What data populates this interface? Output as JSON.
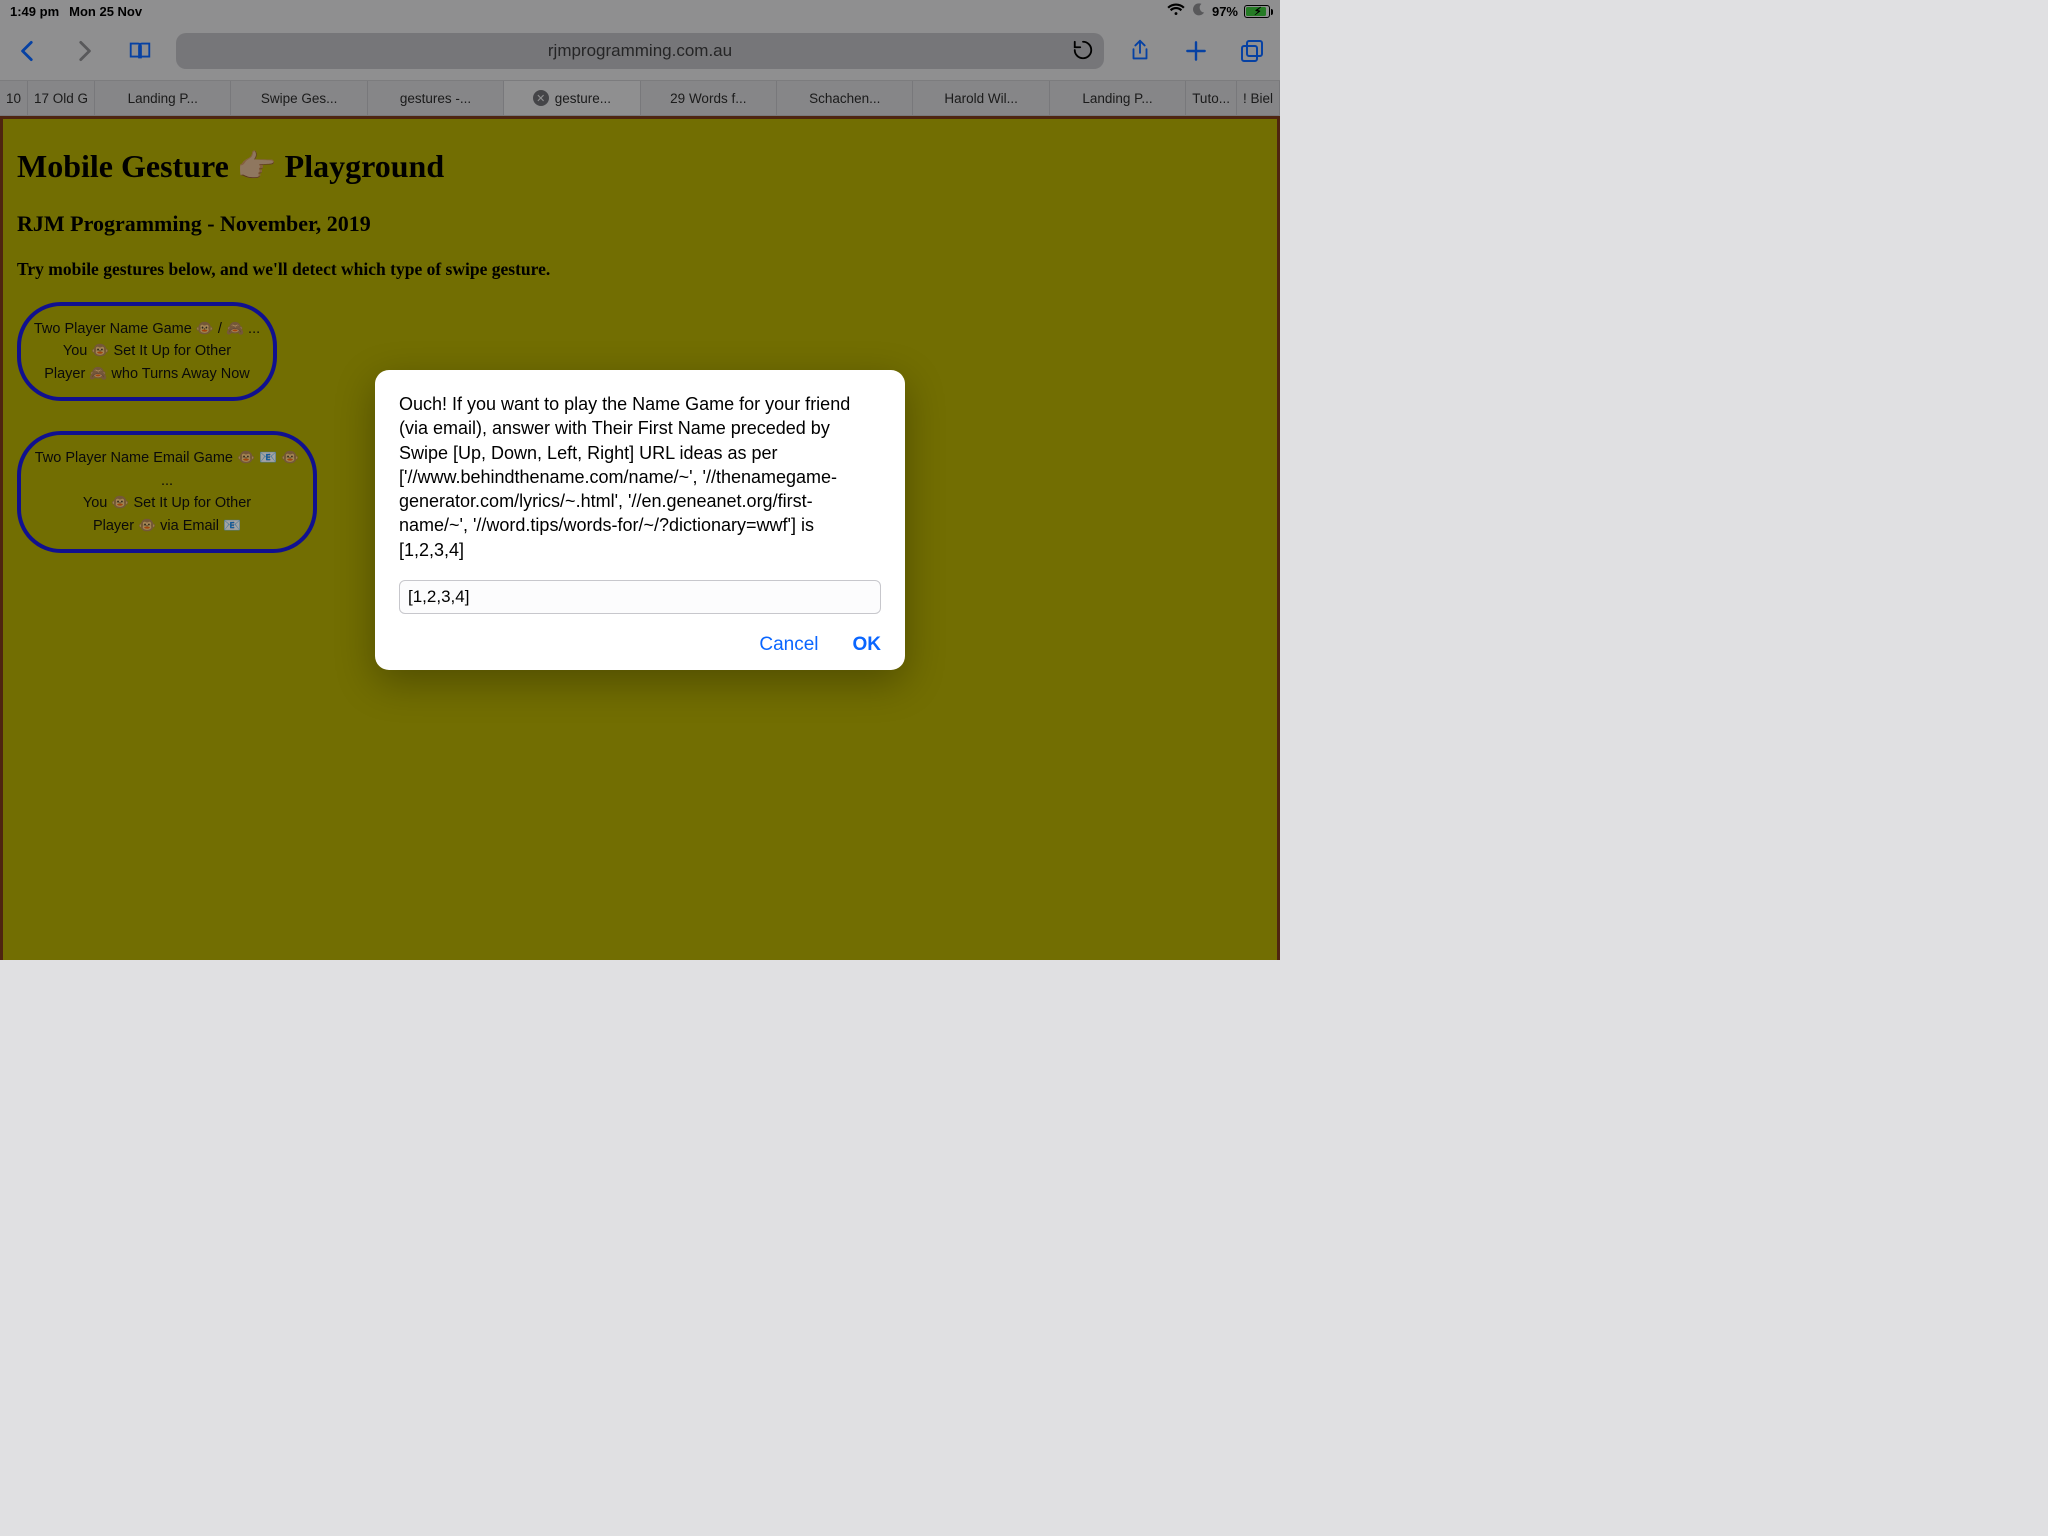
{
  "status": {
    "time": "1:49 pm",
    "date": "Mon 25 Nov",
    "battery_pct": "97%"
  },
  "toolbar": {
    "url_display": "rjmprogramming.com.au"
  },
  "tabs": [
    {
      "label": "10",
      "active": false,
      "narrow": true
    },
    {
      "label": "17 Old G",
      "active": false,
      "narrow": true
    },
    {
      "label": "Landing P...",
      "active": false
    },
    {
      "label": "Swipe Ges...",
      "active": false
    },
    {
      "label": "gestures -...",
      "active": false
    },
    {
      "label": "gesture...",
      "active": true,
      "closeable": true
    },
    {
      "label": "29 Words f...",
      "active": false
    },
    {
      "label": "Schachen...",
      "active": false
    },
    {
      "label": "Harold Wil...",
      "active": false
    },
    {
      "label": "Landing P...",
      "active": false
    },
    {
      "label": "Tuto...",
      "active": false,
      "narrow": true
    },
    {
      "label": "! Biel",
      "active": false,
      "narrow": true
    }
  ],
  "page": {
    "h1_a": "Mobile Gesture ",
    "h1_emoji": "👉🏼",
    "h1_b": " Playground",
    "h2": "RJM Programming - November, 2019",
    "h3": "Try mobile gestures below, and we'll detect which type of swipe gesture.",
    "bubble1_l1": "Two Player Name Game 🐵 / 🙈 ...",
    "bubble1_l2": "You 🐵 Set It Up for Other",
    "bubble1_l3": "Player 🙈 who Turns Away Now",
    "bubble2_l1": "Two Player Name Email Game 🐵 📧 🐵 ...",
    "bubble2_l2": "You 🐵 Set It Up for Other",
    "bubble2_l3": "Player 🐵 via Email 📧"
  },
  "dialog": {
    "message": "Ouch!  If you want to play the Name Game for your friend (via email), answer with Their First Name preceded by Swipe [Up, Down, Left, Right] URL ideas as per ['//www.behindthename.com/name/~', '//thenamegame-generator.com/lyrics/~.html', '//en.geneanet.org/first-name/~', '//word.tips/words-for/~/?dictionary=wwf'] is [1,2,3,4]",
    "input_value": "[1,2,3,4]",
    "cancel": "Cancel",
    "ok": "OK"
  }
}
